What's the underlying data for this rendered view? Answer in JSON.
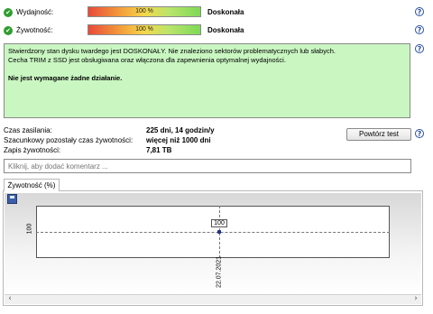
{
  "performance": {
    "label": "Wydajność:",
    "value_text": "100 %",
    "value": 100,
    "status": "Doskonała"
  },
  "health": {
    "label": "Żywotność:",
    "value_text": "100 %",
    "value": 100,
    "status": "Doskonała"
  },
  "description": {
    "line1": "Stwierdzony stan dysku twardego jest DOSKONAŁY. Nie znaleziono sektorów problematycznych lub słabych.",
    "line2": "Cecha TRIM z SSD jest obsługiwana oraz włączona dla zapewnienia optymalnej wydajności.",
    "action": "Nie jest wymagane żadne działanie."
  },
  "info": {
    "power_on_label": "Czas zasilania:",
    "power_on_value": "225 dni, 14 godzin/y",
    "remaining_label": "Szacunkowy pozostały czas żywotności:",
    "remaining_value": "więcej niż 1000 dni",
    "written_label": "Zapis żywotności:",
    "written_value": "7,81 TB"
  },
  "retest_button": "Powtórz test",
  "comment_placeholder": "Kliknij, aby dodać komentarz ...",
  "tab_label": "Żywotność (%)",
  "help_glyph": "?",
  "check_glyph": "✔",
  "scroll": {
    "left": "‹",
    "right": "›"
  },
  "chart_data": {
    "type": "line",
    "x": [
      "22.07.2021"
    ],
    "series": [
      {
        "values": [
          100
        ]
      }
    ],
    "data_labels": [
      "100"
    ],
    "y_ticks": [
      "100"
    ],
    "grid": true,
    "colors": {
      "point": "#1a2f8a"
    }
  },
  "colors": {
    "description_bg": "#c9f6c1",
    "check": "#2e9e2e",
    "help": "#2a4f9e"
  }
}
